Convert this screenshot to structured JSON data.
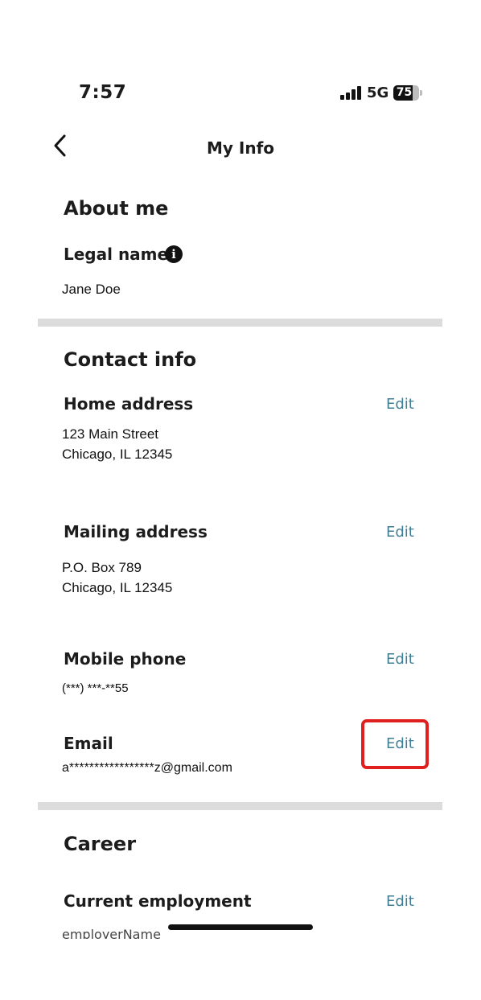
{
  "status_bar": {
    "time": "7:57",
    "network": "5G",
    "battery": "75",
    "battery_level_percent": 75
  },
  "header": {
    "title": "My Info"
  },
  "about_me": {
    "title": "About me",
    "legal_name_label": "Legal name",
    "legal_name_value": "Jane Doe"
  },
  "contact_info": {
    "title": "Contact info",
    "home_address": {
      "label": "Home address",
      "edit": "Edit",
      "line1": "123 Main Street",
      "line2": "Chicago, IL 12345"
    },
    "mailing_address": {
      "label": "Mailing address",
      "edit": "Edit",
      "line1": "P.O. Box 789",
      "line2": "Chicago, IL 12345"
    },
    "mobile_phone": {
      "label": "Mobile phone",
      "edit": "Edit",
      "value": "(***) ***-**55"
    },
    "email": {
      "label": "Email",
      "edit": "Edit",
      "value": "a*****************z@gmail.com"
    }
  },
  "career": {
    "title": "Career",
    "current_employment": {
      "label": "Current employment",
      "edit": "Edit",
      "value": "employerName"
    }
  },
  "colors": {
    "edit_link": "#3f7f95",
    "divider": "#dcdcdc",
    "highlight": "#e0201e"
  }
}
